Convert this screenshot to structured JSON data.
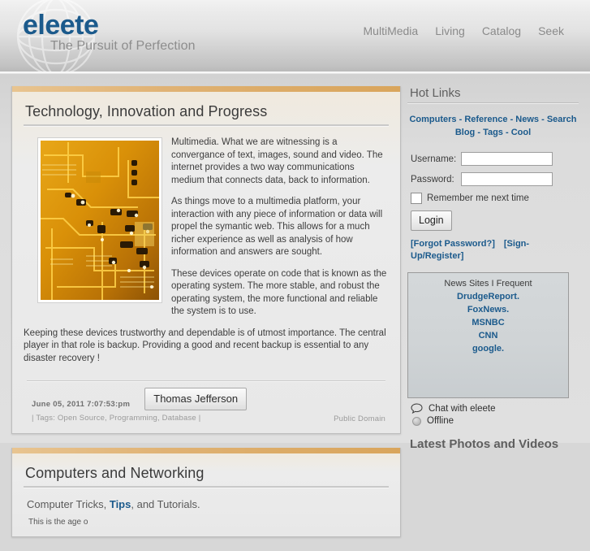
{
  "header": {
    "logo_text": "eleete",
    "tagline": "The Pursuit of Perfection",
    "nav": [
      {
        "label": "MultiMedia"
      },
      {
        "label": "Living"
      },
      {
        "label": "Catalog"
      },
      {
        "label": "Seek"
      }
    ]
  },
  "main": {
    "articles": [
      {
        "title": "Technology, Innovation and Progress",
        "paragraphs": [
          "Multimedia. What we are witnessing is a convergance of text, images, sound and video. The internet provides a two way communications medium that connects data, back to information.",
          "As things move to a multimedia platform, your interaction with any piece of information or data will propel the symantic web. This allows for a much richer experience as well as analysis of how information and answers are sought.",
          "These devices operate on code that is known as the operating system. The more stable, and robust the operating system, the more functional and reliable the system is to use.",
          "Keeping these devices trustworthy and dependable is of utmost importance. The central player in that role is backup. Providing a good and recent backup is essential to any disaster recovery !"
        ],
        "date": "June 05, 2011 7:07:53:pm",
        "author": "Thomas Jefferson",
        "tags_text": "| Tags: Open Source, Programming, Database |",
        "rights": "Public Domain",
        "thumb_alt": "circuit-board-photo"
      },
      {
        "title": "Computers and Networking",
        "subtitle_prefix": "Computer Tricks, ",
        "subtitle_link": "Tips",
        "subtitle_suffix": ", and Tutorials.",
        "clipped_text": "This is the age o"
      }
    ]
  },
  "sidebar": {
    "hot_links_heading": "Hot Links",
    "hot_links_row1": [
      "Computers",
      "Reference",
      "News",
      "Search"
    ],
    "hot_links_row2": [
      "Blog",
      "Tags",
      "Cool"
    ],
    "hot_links_separator": " - ",
    "login": {
      "username_label": "Username:",
      "username_value": "",
      "username_placeholder": "",
      "password_label": "Password:",
      "password_value": "",
      "password_placeholder": "",
      "remember_label": "Remember me next time",
      "remember_checked": false,
      "login_button": "Login",
      "forgot_link": "[Forgot Password?]",
      "signup_link": "[Sign-Up/Register]"
    },
    "news_box": {
      "title": "News Sites I Frequent",
      "sites": [
        "DrudgeReport.",
        "FoxNews.",
        "MSNBC",
        "CNN",
        "google."
      ]
    },
    "chat": {
      "label": "Chat with eleete",
      "status": "Offline"
    },
    "bottom_heading": "Latest Photos and Videos"
  },
  "colors": {
    "brand_blue": "#1b5a8c",
    "card_accent": "#dcab66",
    "page_bg": "#dcdcdc",
    "sidebar_text": "#3c3c3c"
  }
}
